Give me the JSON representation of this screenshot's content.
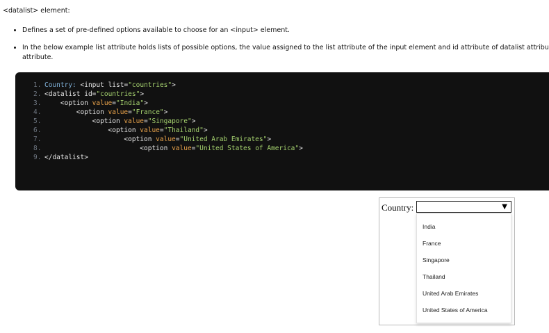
{
  "intro": "<datalist> element:",
  "bullets": [
    "Defines a set of pre-defined options available to choose for an <input> element.",
    "In the below example list attribute holds lists of possible options, the value assigned to the list attribute of the input element and id attribute of datalist attribu",
    "attribute."
  ],
  "code": {
    "line_numbers": [
      "1.",
      "2.",
      "3.",
      "4.",
      "5.",
      "6.",
      "7.",
      "8.",
      "9."
    ],
    "tokens": {
      "country_label": "Country:",
      "input_open": "<input",
      "list_attr": "list",
      "countries_str": "\"countries\"",
      "gt": ">",
      "datalist_open": "<datalist",
      "id_attr": "id",
      "option_open": "<option",
      "value_attr": "value",
      "eq": "=",
      "india": "\"India\"",
      "france": "\"France\"",
      "singapore": "\"Singapore\"",
      "thailand": "\"Thailand\"",
      "uae": "\"United Arab Emirates\"",
      "usa": "\"United States of America\"",
      "datalist_close": "</datalist>"
    }
  },
  "demo": {
    "label": "Country:",
    "arrow": "▼",
    "options": [
      "India",
      "France",
      "Singapore",
      "Thailand",
      "United Arab Emirates",
      "United States of America"
    ]
  }
}
